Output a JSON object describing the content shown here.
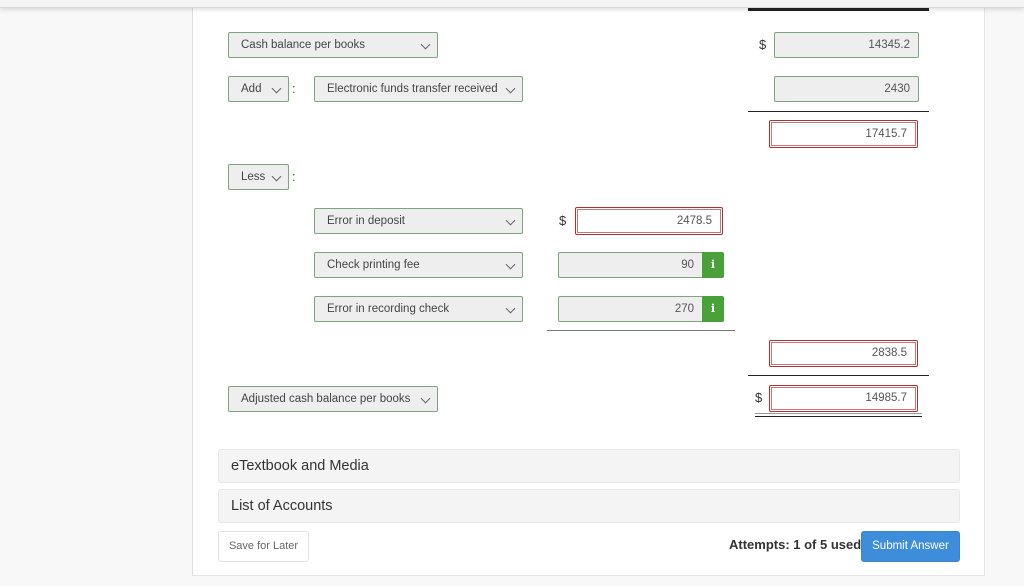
{
  "form": {
    "start_row": {
      "label": "Cash balance per books",
      "currency": "$",
      "amount": "14345.2"
    },
    "add_section": {
      "operator": "Add",
      "colon": ":",
      "items": [
        {
          "label": "Electronic funds transfer received",
          "amount": "2430"
        }
      ],
      "subtotal": "17415.7"
    },
    "less_section": {
      "operator": "Less",
      "colon": ":",
      "currency": "$",
      "items": [
        {
          "label": "Error in deposit",
          "amount": "2478.5",
          "state": "incorrect"
        },
        {
          "label": "Check printing fee",
          "amount": "90",
          "state": "correct",
          "info_icon": "i"
        },
        {
          "label": "Error in recording check",
          "amount": "270",
          "state": "correct",
          "info_icon": "i"
        }
      ],
      "total": "2838.5"
    },
    "end_row": {
      "label": "Adjusted cash balance per books",
      "currency": "$",
      "amount": "14985.7"
    }
  },
  "accordions": [
    {
      "label": "eTextbook and Media"
    },
    {
      "label": "List of Accounts"
    }
  ],
  "footer": {
    "save_label": "Save for Later",
    "attempts_text": "Attempts: 1 of 5 used",
    "submit_label": "Submit Answer"
  },
  "colors": {
    "correct_border": "#7fa57f",
    "incorrect_border": "#aa3333",
    "info_badge": "#4aa13a",
    "submit_button": "#3d8ddb"
  }
}
